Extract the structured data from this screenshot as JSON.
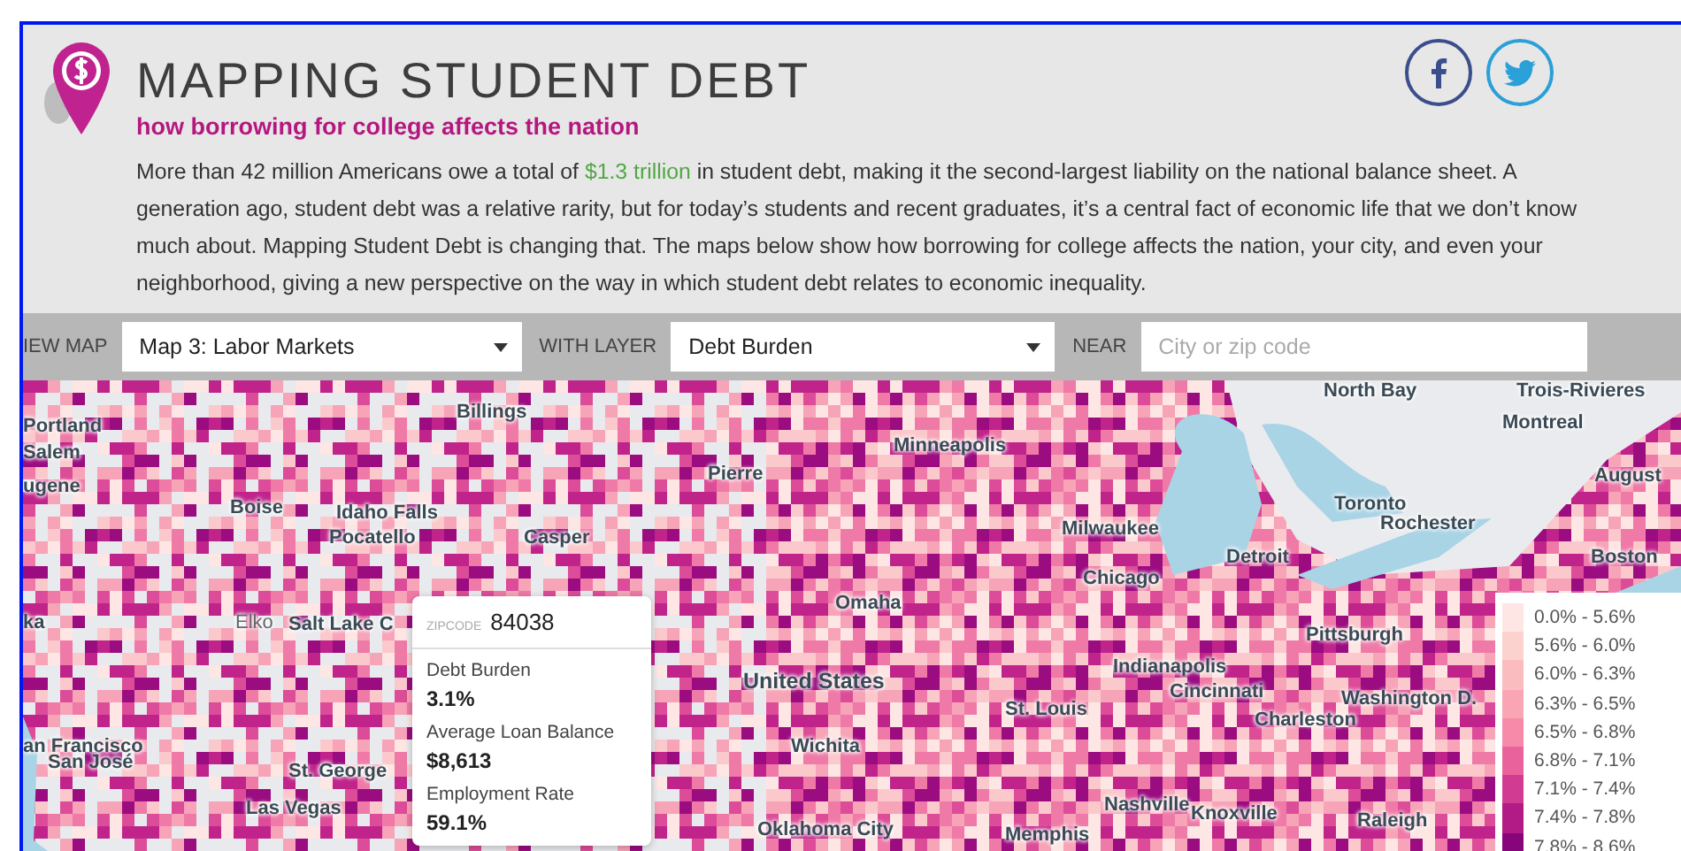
{
  "header": {
    "title": "MAPPING STUDENT DEBT",
    "subtitle": "how borrowing for college affects the nation",
    "intro": {
      "before": "More than 42 million Americans owe a total of ",
      "link": "$1.3 trillion",
      "after": " in student debt, making it the second-largest liability on the national balance sheet. A generation ago, student debt was a relative rarity, but for today’s students and recent graduates, it’s a central fact of economic life that we don’t know much about. Mapping Student Debt is changing that. The maps below show how borrowing for college affects the nation, your city, and even your neighborhood, giving a new perspective on the way in which student debt relates to economic inequality."
    }
  },
  "toolbar": {
    "view_label": "IEW MAP",
    "view_value": "Map 3: Labor Markets",
    "layer_label": "WITH LAYER",
    "layer_value": "Debt Burden",
    "near_label": "NEAR",
    "near_placeholder": "City or zip code"
  },
  "map": {
    "labels": [
      {
        "text": "Portland",
        "kind": "city"
      },
      {
        "text": "Salem",
        "kind": "city"
      },
      {
        "text": "ugene",
        "kind": "city"
      },
      {
        "text": "ka",
        "kind": "city"
      },
      {
        "text": "Boise",
        "kind": "city"
      },
      {
        "text": "Idaho Falls",
        "kind": "city"
      },
      {
        "text": "Pocatello",
        "kind": "city"
      },
      {
        "text": "Billings",
        "kind": "city"
      },
      {
        "text": "Casper",
        "kind": "city"
      },
      {
        "text": "Pierre",
        "kind": "city"
      },
      {
        "text": "Elko",
        "kind": "town"
      },
      {
        "text": "Salt Lake C",
        "kind": "city"
      },
      {
        "text": "an Francisco",
        "kind": "city"
      },
      {
        "text": "San José",
        "kind": "city"
      },
      {
        "text": "St. George",
        "kind": "city"
      },
      {
        "text": "Las Vegas",
        "kind": "city"
      },
      {
        "text": "United States",
        "kind": "country"
      },
      {
        "text": "Wichita",
        "kind": "city"
      },
      {
        "text": "Oklahoma City",
        "kind": "city"
      },
      {
        "text": "Minneapolis",
        "kind": "city"
      },
      {
        "text": "Omaha",
        "kind": "city"
      },
      {
        "text": "St. Louis",
        "kind": "city"
      },
      {
        "text": "Milwaukee",
        "kind": "city"
      },
      {
        "text": "Chicago",
        "kind": "city"
      },
      {
        "text": "Detroit",
        "kind": "city"
      },
      {
        "text": "Toronto",
        "kind": "city"
      },
      {
        "text": "Rochester",
        "kind": "city"
      },
      {
        "text": "North Bay",
        "kind": "city"
      },
      {
        "text": "Trois-Rivieres",
        "kind": "city"
      },
      {
        "text": "Montreal",
        "kind": "city"
      },
      {
        "text": "August",
        "kind": "city"
      },
      {
        "text": "Boston",
        "kind": "city"
      },
      {
        "text": "Pittsburgh",
        "kind": "city"
      },
      {
        "text": "Indianapolis",
        "kind": "city"
      },
      {
        "text": "Cincinnati",
        "kind": "city"
      },
      {
        "text": "Charleston",
        "kind": "city"
      },
      {
        "text": "Washington D.",
        "kind": "city"
      },
      {
        "text": "Nashville",
        "kind": "city"
      },
      {
        "text": "Knoxville",
        "kind": "city"
      },
      {
        "text": "Raleigh",
        "kind": "city"
      },
      {
        "text": "Memphis",
        "kind": "city"
      }
    ],
    "tooltip": {
      "key_label": "ZIPCODE",
      "key_value": "84038",
      "fields": [
        {
          "label": "Debt Burden",
          "value": "3.1%"
        },
        {
          "label": "Average Loan Balance",
          "value": "$8,613"
        },
        {
          "label": "Employment Rate",
          "value": "59.1%"
        }
      ]
    },
    "legend": [
      {
        "label": "0.0% - 5.6%",
        "color": "#fde6e3"
      },
      {
        "label": "5.6% - 6.0%",
        "color": "#fcd2cf"
      },
      {
        "label": "6.0% - 6.3%",
        "color": "#fbbcc0"
      },
      {
        "label": "6.3% - 6.5%",
        "color": "#f9a5b4"
      },
      {
        "label": "6.5% - 6.8%",
        "color": "#f78aa8"
      },
      {
        "label": "6.8% - 7.1%",
        "color": "#ea629c"
      },
      {
        "label": "7.1% - 7.4%",
        "color": "#d23b92"
      },
      {
        "label": "7.4% - 7.8%",
        "color": "#b21a86"
      },
      {
        "label": "7.8% - 8.6%",
        "color": "#86057a"
      }
    ]
  }
}
